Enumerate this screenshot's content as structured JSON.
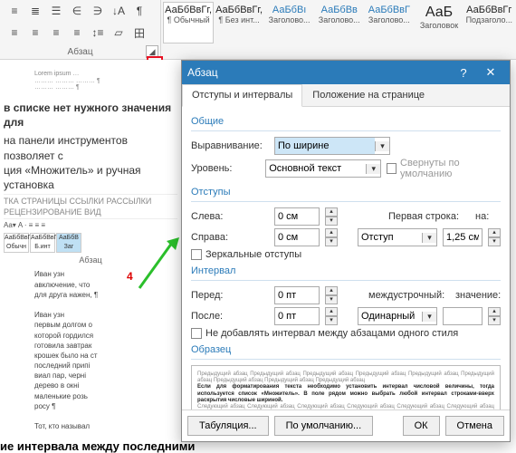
{
  "ribbon": {
    "group_label": "Абзац",
    "styles": [
      {
        "preview": "АаБбВвГг,",
        "name": "¶ Обычный"
      },
      {
        "preview": "АаБбВвГг,",
        "name": "¶ Без инт..."
      },
      {
        "preview": "АаБбВı",
        "name": "Заголово..."
      },
      {
        "preview": "АаБбВв",
        "name": "Заголово..."
      },
      {
        "preview": "АаБбВвГ",
        "name": "Заголово..."
      },
      {
        "preview": "АаБ",
        "name": "Заголовок"
      },
      {
        "preview": "АаБбВвГг",
        "name": "Подзаголо..."
      }
    ]
  },
  "doc_fragments": {
    "line1": "в списке нет нужного значения для",
    "line2": "на панели инструментов позволяет с",
    "line3": "ция «Множитель» и ручная установка",
    "tabs_small": "ТКА СТРАНИЦЫ   ССЫЛКИ   РАССЫЛКИ   РЕЦЕНЗИРОВАНИЕ   ВИД",
    "abzac_mini": "Абзац",
    "body_lines": [
      "Иван узн",
      "авключение, что",
      "для друга нажен,",
      "Иван узн",
      "первым долгом о",
      "которой гордился",
      "готовила завтрак",
      "крошек было на ст",
      "последний припі",
      "виал пар, черні",
      "дерево в окні",
      "маленькие розь",
      "росу ¶",
      "Тот, кто называл"
    ],
    "footer_bold": "ие интервала между последними"
  },
  "markers": {
    "four": "4"
  },
  "dialog": {
    "title": "Абзац",
    "tabs": {
      "t1": "Отступы и интервалы",
      "t2": "Положение на странице"
    },
    "sec_general": "Общие",
    "align_label": "Выравнивание:",
    "align_value": "По ширине",
    "level_label": "Уровень:",
    "level_value": "Основной текст",
    "collapse_chk": "Свернуты по умолчанию",
    "sec_indent": "Отступы",
    "left_label": "Слева:",
    "left_value": "0 см",
    "right_label": "Справа:",
    "right_value": "0 см",
    "first_line_label": "Первая строка:",
    "first_line_value": "Отступ",
    "by_label": "на:",
    "by_value": "1,25 см",
    "mirror_chk": "Зеркальные отступы",
    "sec_spacing": "Интервал",
    "before_label": "Перед:",
    "before_value": "0 пт",
    "after_label": "После:",
    "after_value": "0 пт",
    "line_spacing_label": "междустрочный:",
    "line_spacing_value": "Одинарный",
    "value_label": "значение:",
    "no_space_chk": "Не добавлять интервал между абзацами одного стиля",
    "sec_preview": "Образец",
    "preview_gray": "Предыдущий абзац Предыдущий абзац Предыдущий абзац Предыдущий абзац Предыдущий абзац Предыдущий абзац Предыдущий абзац Предыдущий абзац Предыдущий абзац",
    "preview_bold": "Если для форматирования текста необходимо установить интервал числовой величины, тогда используется список «Множитель». В поле рядом можно выбрать любой интервал строками-вверх раскрытия числовые шириной.",
    "preview_after": "Следующий абзац Следующий абзац Следующий абзац Следующий абзац Следующий абзац Следующий абзац Следующий абзац Следующий абзац Следующий абзац Следующий абзац",
    "btn_tabs": "Табуляция...",
    "btn_default": "По умолчанию...",
    "btn_ok": "ОК",
    "btn_cancel": "Отмена"
  }
}
